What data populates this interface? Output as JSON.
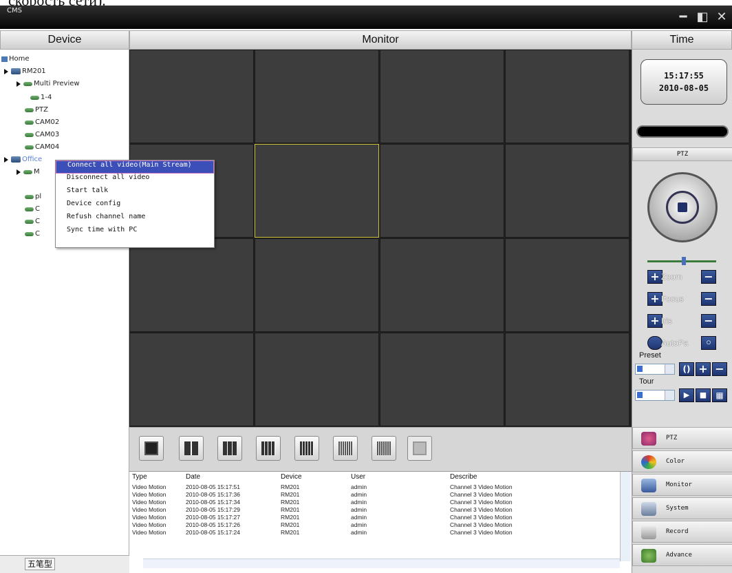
{
  "caption": "скорость сети).",
  "window": {
    "title": "CMS",
    "minimize": "━",
    "restore": "◧",
    "close": "✕"
  },
  "headers": {
    "device": "Device",
    "monitor": "Monitor",
    "time": "Time"
  },
  "tree": {
    "home": "Home",
    "rm201": "RM201",
    "multi_preview": "Multi Preview",
    "ch_1_4": "1-4",
    "ptz": "PTZ",
    "cam02": "CAM02",
    "cam03": "CAM03",
    "cam04": "CAM04",
    "office": "Office",
    "office_child": "M",
    "partial1": "pl",
    "partial2": "C",
    "partial3": "C",
    "partial4": "C"
  },
  "context_menu": [
    "Connect all video(Main Stream)",
    "Disconnect all video",
    "Start talk",
    "Device config",
    "Refush channel name",
    "Sync time with PC"
  ],
  "log": {
    "columns": [
      "Type",
      "Date",
      "Device",
      "User",
      "Describe"
    ],
    "rows": [
      [
        "Video Motion",
        "2010-08-05 15:17:51",
        "RM201",
        "admin",
        "Channel 3 Video Motion"
      ],
      [
        "Video Motion",
        "2010-08-05 15:17:36",
        "RM201",
        "admin",
        "Channel 3 Video Motion"
      ],
      [
        "Video Motion",
        "2010-08-05 15:17:34",
        "RM201",
        "admin",
        "Channel 3 Video Motion"
      ],
      [
        "Video Motion",
        "2010-08-05 15:17:29",
        "RM201",
        "admin",
        "Channel 3 Video Motion"
      ],
      [
        "Video Motion",
        "2010-08-05 15:17:27",
        "RM201",
        "admin",
        "Channel 3 Video Motion"
      ],
      [
        "Video Motion",
        "2010-08-05 15:17:26",
        "RM201",
        "admin",
        "Channel 3 Video Motion"
      ],
      [
        "Video Motion",
        "2010-08-05 15:17:24",
        "RM201",
        "admin",
        "Channel 3 Video Motion"
      ]
    ]
  },
  "clock": {
    "time": "15:17:55",
    "date": "2010-08-05"
  },
  "ptz": {
    "header": "PTZ",
    "zoom": "Zoom",
    "focus": "Focus",
    "iris": "Iris",
    "autopan": "AutoPa",
    "preset": "Preset",
    "tour": "Tour"
  },
  "nav": [
    "PTZ",
    "Color",
    "Monitor",
    "System",
    "Record",
    "Advance"
  ],
  "ime": {
    "text": "五笔型"
  },
  "colors": {
    "accent": "#3c4fb8",
    "grid_active": "#cfc239",
    "cell": "#3d3d3d",
    "titlebar": "#050505"
  },
  "icons": [
    "minimize-icon",
    "restore-icon",
    "close-icon",
    "joystick-icon",
    "plus-icon",
    "minus-icon",
    "play-icon",
    "stop-icon",
    "grid-icon",
    "fullscreen-icon"
  ]
}
